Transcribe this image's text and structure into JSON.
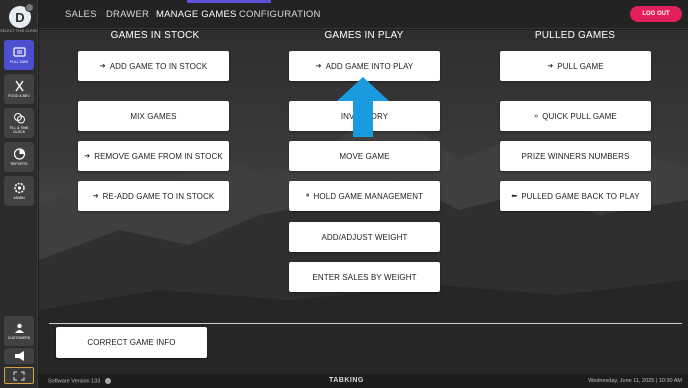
{
  "sidebar": {
    "avatar_letter": "D",
    "select_clerk_label": "SELECT THIS CLERK",
    "items": [
      {
        "label": "PULL TABS",
        "icon": "ticket-icon",
        "active": true
      },
      {
        "label": "FOOD & BEV",
        "icon": "fork-knife-icon",
        "active": false
      },
      {
        "label": "TILL & TIME CLOCK",
        "icon": "coins-icon",
        "active": false
      },
      {
        "label": "REPORTS",
        "icon": "pie-chart-icon",
        "active": false
      },
      {
        "label": "ADMIN",
        "icon": "gear-icon",
        "active": false
      }
    ],
    "bottom_items": [
      {
        "label": "CUSTOMERS",
        "icon": "customers-icon"
      },
      {
        "label": "",
        "icon": "megaphone-icon"
      }
    ]
  },
  "topnav": {
    "tabs": [
      "SALES",
      "DRAWER",
      "MANAGE GAMES",
      "CONFIGURATION"
    ],
    "active_tab": "MANAGE GAMES",
    "logout_label": "LOG OUT"
  },
  "columns": {
    "in_stock": {
      "title": "GAMES IN STOCK",
      "buttons": [
        "ADD GAME TO IN STOCK",
        "MIX GAMES",
        "REMOVE GAME FROM IN STOCK",
        "RE-ADD GAME TO IN STOCK"
      ]
    },
    "in_play": {
      "title": "GAMES IN PLAY",
      "buttons": [
        "ADD GAME INTO PLAY",
        "INVENTORY",
        "MOVE GAME",
        "HOLD GAME MANAGEMENT",
        "ADD/ADJUST WEIGHT",
        "ENTER SALES BY WEIGHT"
      ]
    },
    "pulled": {
      "title": "PULLED GAMES",
      "buttons": [
        "PULL GAME",
        "QUICK PULL GAME",
        "PRIZE WINNERS NUMBERS",
        "PULLED GAME BACK TO PLAY"
      ]
    }
  },
  "correct_game_info_label": "CORRECT GAME INFO",
  "footer": {
    "version": "Software Version 133",
    "brand": "TABKING",
    "datetime": "Wednesday, June 11, 2025 | 10:30 AM"
  },
  "colors": {
    "accent": "#4b4fd0",
    "logout": "#e01f5b",
    "arrow": "#1a9be0"
  }
}
